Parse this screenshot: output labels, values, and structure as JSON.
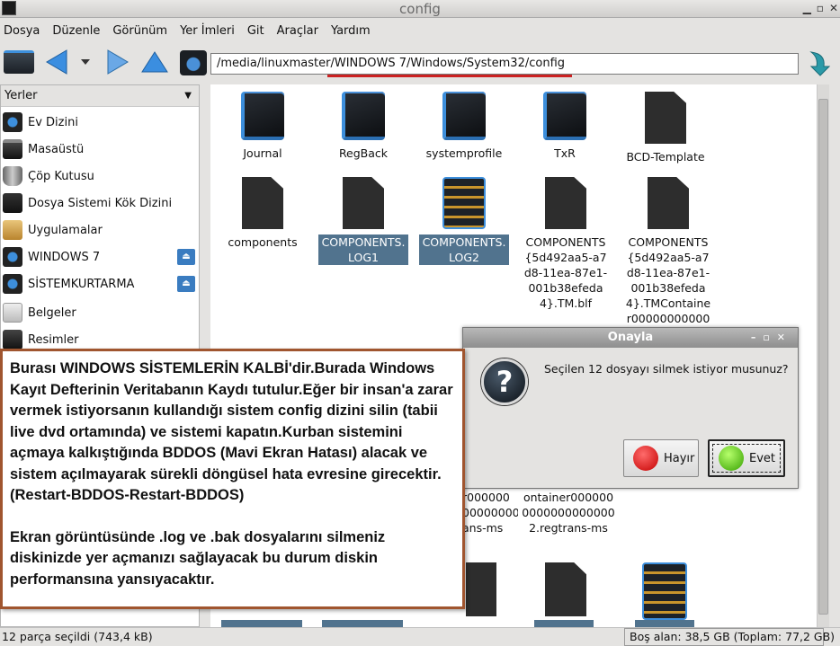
{
  "window": {
    "title": "config"
  },
  "menu": [
    "Dosya",
    "Düzenle",
    "Görünüm",
    "Yer İmleri",
    "Git",
    "Araçlar",
    "Yardım"
  ],
  "address": {
    "path": "/media/linuxmaster/WINDOWS 7/Windows/System32/config"
  },
  "sidebar": {
    "header": "Yerler",
    "items": [
      {
        "label": "Ev Dizini"
      },
      {
        "label": "Masaüstü"
      },
      {
        "label": "Çöp Kutusu"
      },
      {
        "label": "Dosya Sistemi Kök Dizini"
      },
      {
        "label": "Uygulamalar"
      },
      {
        "label": "WINDOWS 7"
      },
      {
        "label": "SİSTEMKURTARMA"
      },
      {
        "label": "Belgeler"
      },
      {
        "label": "Resimler"
      }
    ]
  },
  "files": [
    {
      "name": "Journal",
      "kind": "folder"
    },
    {
      "name": "RegBack",
      "kind": "folder"
    },
    {
      "name": "systemprofile",
      "kind": "folder"
    },
    {
      "name": "TxR",
      "kind": "folder"
    },
    {
      "name": "BCD-Template",
      "kind": "file"
    },
    {
      "name": "components",
      "kind": "file"
    },
    {
      "name": "COMPONENTS.LOG1",
      "kind": "file",
      "selected": true
    },
    {
      "name": "COMPONENTS.LOG2",
      "kind": "textfile",
      "selected": true
    },
    {
      "name": "COMPONENTS{5d492aa5-a7d8-11ea-87e1-001b38efeda4}.TM.blf",
      "kind": "file"
    },
    {
      "name": "COMPONENTS{5d492aa5-a7d8-11ea-87e1-001b38efeda4}.TMContainer000000000000000",
      "kind": "file"
    }
  ],
  "partial_labels": {
    "col3": [
      "r000000",
      "00000000",
      "ans-ms"
    ],
    "col4": [
      "ontainer000000",
      "0000000000000",
      "2.regtrans-ms"
    ]
  },
  "status": {
    "selection": "12 parça seçildi (743,4 kB)",
    "space": "Boş alan: 38,5 GB (Toplam: 77,2 GB)"
  },
  "dialog": {
    "title": "Onayla",
    "message": "Seçilen 12 dosyayı silmek istiyor musunuz?",
    "no_label": "Hayır",
    "yes_label": "Evet"
  },
  "annotation": {
    "para1": "Burası WINDOWS SİSTEMLERİN KALBİ'dir.Burada Windows Kayıt Defterinin Veritabanın Kaydı tutulur.Eğer bir insan'a zarar vermek istiyorsanın kullandığı sistem config dizini silin (tabii live dvd ortamında) ve sistemi kapatın.Kurban sistemini açmaya kalkıştığında BDDOS (Mavi Ekran Hatası) alacak ve sistem açılmayarak sürekli döngüsel hata evresine girecektir.(Restart-BDDOS-Restart-BDDOS)",
    "para2": "Ekran görüntüsünde .log ve .bak dosyalarını silmeniz diskinizde yer açmanızı sağlayacak bu durum diskin performansına yansıyacaktır."
  },
  "colors": {
    "selection": "#51738e",
    "annotation_border": "#a0552f",
    "address_underline": "#cc2222"
  }
}
